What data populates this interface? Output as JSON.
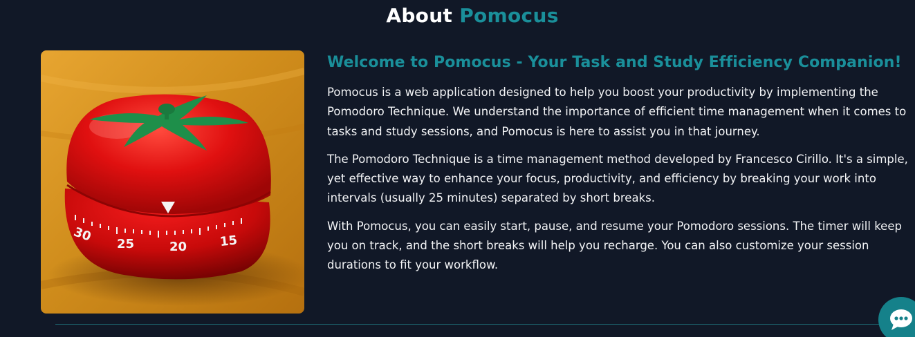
{
  "about": {
    "heading_word": "About",
    "heading_brand": "Pomocus",
    "image_icon": "pomodoro-tomato-timer-photo",
    "subtitle": "Welcome to Pomocus - Your Task and Study Efficiency Companion!",
    "paragraphs": [
      "Pomocus is a web application designed to help you boost your productivity by implementing the Pomodoro Technique. We understand the importance of efficient time management when it comes to tasks and study sessions, and Pomocus is here to assist you in that journey.",
      "The Pomodoro Technique is a time management method developed by Francesco Cirillo. It's a simple, yet effective way to enhance your focus, productivity, and efficiency by breaking your work into intervals (usually 25 minutes) separated by short breaks.",
      "With Pomocus, you can easily start, pause, and resume your Pomodoro sessions. The timer will keep you on track, and the short breaks will help you recharge. You can also customize your session durations to fit your workflow."
    ],
    "timer_dial_labels": [
      "30",
      "25",
      "20",
      "15"
    ]
  },
  "chat": {
    "icon": "chat-bubble-icon"
  },
  "colors": {
    "background": "#111827",
    "accent": "#1a8f9a",
    "text": "#f3f4f6",
    "chat_button": "#15818a"
  }
}
